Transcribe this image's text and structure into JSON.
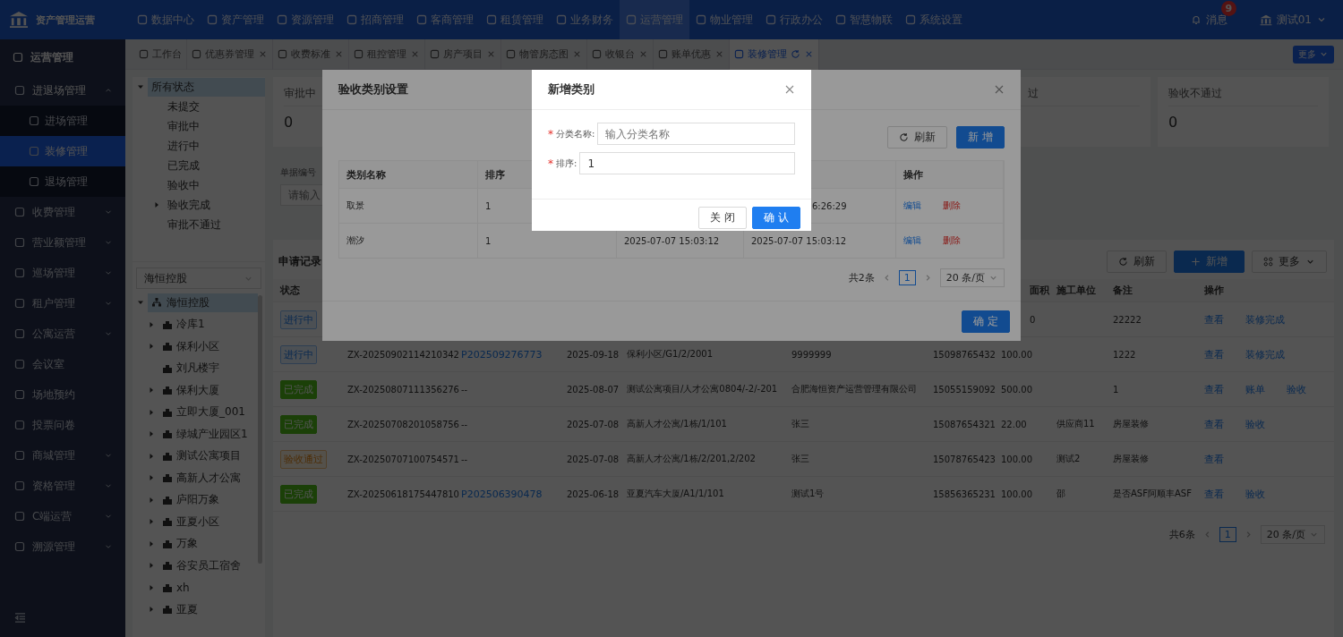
{
  "app": {
    "title": "资产管理运营"
  },
  "top_nav": [
    {
      "label": "数据中心",
      "selected": false
    },
    {
      "label": "资产管理",
      "selected": false
    },
    {
      "label": "资源管理",
      "selected": false
    },
    {
      "label": "招商管理",
      "selected": false
    },
    {
      "label": "客商管理",
      "selected": false
    },
    {
      "label": "租赁管理",
      "selected": false
    },
    {
      "label": "业务财务",
      "selected": false
    },
    {
      "label": "运营管理",
      "selected": true
    },
    {
      "label": "物业管理",
      "selected": false
    },
    {
      "label": "行政办公",
      "selected": false
    },
    {
      "label": "智慧物联",
      "selected": false
    },
    {
      "label": "系统设置",
      "selected": false
    }
  ],
  "messages": {
    "label": "消息",
    "badge": "9"
  },
  "user": {
    "name": "测试01"
  },
  "sidebar": {
    "title": "运营管理",
    "items": [
      {
        "label": "进退场管理",
        "expanded": true,
        "children": [
          {
            "label": "进场管理",
            "selected": false
          },
          {
            "label": "装修管理",
            "selected": true
          },
          {
            "label": "退场管理",
            "selected": false
          }
        ]
      },
      {
        "label": "收费管理",
        "expanded": false
      },
      {
        "label": "营业额管理",
        "expanded": false
      },
      {
        "label": "巡场管理",
        "expanded": false
      },
      {
        "label": "租户管理",
        "expanded": false
      },
      {
        "label": "公寓运营",
        "expanded": false
      },
      {
        "label": "会议室"
      },
      {
        "label": "场地预约"
      },
      {
        "label": "投票问卷"
      },
      {
        "label": "商城管理",
        "expanded": false
      },
      {
        "label": "资格管理",
        "expanded": false
      },
      {
        "label": "C端运营",
        "expanded": false
      },
      {
        "label": "溯源管理",
        "expanded": false
      }
    ]
  },
  "tabs": [
    {
      "label": "工作台",
      "selected": false,
      "closable": false
    },
    {
      "label": "优惠券管理",
      "selected": false,
      "closable": true
    },
    {
      "label": "收费标准",
      "selected": false,
      "closable": true
    },
    {
      "label": "租控管理",
      "selected": false,
      "closable": true
    },
    {
      "label": "房产项目",
      "selected": false,
      "closable": true
    },
    {
      "label": "物管房态图",
      "selected": false,
      "closable": true
    },
    {
      "label": "收银台",
      "selected": false,
      "closable": true
    },
    {
      "label": "账单优惠",
      "selected": false,
      "closable": true
    },
    {
      "label": "装修管理",
      "selected": true,
      "closable": true
    }
  ],
  "more_tabs": "更多",
  "status_tree": {
    "label": "所有状态",
    "expanded": true,
    "selected": true,
    "children": [
      {
        "label": "未提交",
        "has_children": false
      },
      {
        "label": "审批中",
        "has_children": false
      },
      {
        "label": "进行中",
        "has_children": false
      },
      {
        "label": "已完成",
        "has_children": false
      },
      {
        "label": "验收中",
        "has_children": false
      },
      {
        "label": "验收完成",
        "has_children": true
      },
      {
        "label": "审批不通过",
        "has_children": false
      }
    ]
  },
  "org_select": {
    "value": "海恒控股"
  },
  "org_tree": {
    "label": "海恒控股",
    "expanded": true,
    "selected": true,
    "children": [
      {
        "label": "冷库1",
        "has_children": true
      },
      {
        "label": "保利小区",
        "has_children": true
      },
      {
        "label": "刘凡楼宇",
        "has_children": false
      },
      {
        "label": "保利大厦",
        "has_children": true
      },
      {
        "label": "立即大厦_001",
        "has_children": true
      },
      {
        "label": "绿城产业园区1",
        "has_children": true
      },
      {
        "label": "测试公寓项目",
        "has_children": true
      },
      {
        "label": "高新人才公寓",
        "has_children": true
      },
      {
        "label": "庐阳万象",
        "has_children": true
      },
      {
        "label": "亚夏小区",
        "has_children": true
      },
      {
        "label": "万象",
        "has_children": true
      },
      {
        "label": "谷安员工宿舍",
        "has_children": true
      },
      {
        "label": "xh",
        "has_children": true
      },
      {
        "label": "亚夏",
        "has_children": true
      }
    ]
  },
  "stats": [
    {
      "label": "审批中",
      "value": "0"
    },
    {
      "label": "过",
      "cut": true
    },
    {
      "label": "验收不通过",
      "value": "0"
    }
  ],
  "search": {
    "label": "单据编号",
    "placeholder": "请输入"
  },
  "records": {
    "title": "申请记录",
    "refresh": "刷新",
    "add": "新增",
    "more": "更多",
    "columns": [
      {
        "label": "状态"
      },
      null,
      null,
      null,
      null,
      null,
      null,
      {
        "label": "面积",
        "cut": true
      },
      {
        "label": "施工单位"
      },
      {
        "label": "备注"
      },
      {
        "label": "操作"
      }
    ],
    "rows": [
      {
        "cells": [
          {
            "text": "进行中",
            "kind": "processing"
          },
          {
            "text": ""
          },
          {
            "text": ""
          },
          {
            "text": ""
          },
          {
            "text": ""
          },
          {
            "text": ""
          },
          {
            "text": ""
          },
          {
            "text": "0",
            "cut": true
          },
          {
            "text": ""
          },
          {
            "text": "22222"
          }
        ],
        "actions": [
          "查看",
          "装修完成"
        ]
      },
      {
        "cells": [
          {
            "text": "进行中",
            "kind": "processing"
          },
          {
            "text": "ZX-20250902114210342"
          },
          {
            "text": "P202509276773",
            "link": true
          },
          {
            "text": "2025-09-18"
          },
          {
            "text": "保利小区/G1/2/2001"
          },
          {
            "text": "9999999"
          },
          {
            "text": "15098765432"
          },
          {
            "text": "100.00"
          },
          {
            "text": ""
          },
          {
            "text": "1222"
          }
        ],
        "actions": [
          "查看",
          "装修完成"
        ]
      },
      {
        "cells": [
          {
            "text": "已完成",
            "kind": "done"
          },
          {
            "text": "ZX-20250807111356276"
          },
          {
            "text": "--"
          },
          {
            "text": "2025-08-07"
          },
          {
            "text": "测试公寓项目/人才公寓0804/-2/-201"
          },
          {
            "text": "合肥海恒资产运营管理有限公司"
          },
          {
            "text": "15055159092"
          },
          {
            "text": "500.00"
          },
          {
            "text": ""
          },
          {
            "text": "1"
          }
        ],
        "actions": [
          "查看",
          "账单",
          "验收"
        ]
      },
      {
        "cells": [
          {
            "text": "已完成",
            "kind": "done"
          },
          {
            "text": "ZX-20250708201058756"
          },
          {
            "text": "--"
          },
          {
            "text": "2025-07-08"
          },
          {
            "text": "高新人才公寓/1栋/1/101"
          },
          {
            "text": "张三"
          },
          {
            "text": "15087654321"
          },
          {
            "text": "22.00"
          },
          {
            "text": "供应商11"
          },
          {
            "text": "房屋装修"
          }
        ],
        "actions": [
          "查看",
          "验收"
        ]
      },
      {
        "cells": [
          {
            "text": "验收通过",
            "kind": "passed"
          },
          {
            "text": "ZX-20250707100754571"
          },
          {
            "text": "--"
          },
          {
            "text": "2025-07-08"
          },
          {
            "text": "高新人才公寓/1栋/2/201,2/202"
          },
          {
            "text": "张三"
          },
          {
            "text": "15078765423"
          },
          {
            "text": "100.00"
          },
          {
            "text": "测试2"
          },
          {
            "text": "房屋装修"
          }
        ],
        "actions": [
          "查看"
        ]
      },
      {
        "cells": [
          {
            "text": "已完成",
            "kind": "done"
          },
          {
            "text": "ZX-20250618175447810"
          },
          {
            "text": "P202506390478",
            "link": true
          },
          {
            "text": "2025-06-18"
          },
          {
            "text": "亚夏汽车大厦/A1/1/101"
          },
          {
            "text": "测试1号"
          },
          {
            "text": "15856365231"
          },
          {
            "text": "100.00"
          },
          {
            "text": "邵"
          },
          {
            "text": "是否ASF阿顺丰ASF"
          }
        ],
        "actions": [
          "查看",
          "验收"
        ]
      }
    ],
    "pagination": {
      "total": "共6条",
      "page": "1",
      "size": "20 条/页"
    }
  },
  "category_dialog": {
    "title": "验收类别设置",
    "refresh": "刷新",
    "add": "新 增",
    "columns": [
      "类别名称",
      "排序",
      "操作"
    ],
    "rows": [
      {
        "name": "取景",
        "sort": "1",
        "created": null,
        "updated": {
          "text": "6:26:29",
          "cut": true
        },
        "actions": [
          {
            "text": "编辑",
            "kind": "edit"
          },
          {
            "text": "删除",
            "kind": "delete"
          }
        ]
      },
      {
        "name": "潮汐",
        "sort": "1",
        "created": "2025-07-07 15:03:12",
        "updated": {
          "text": "2025-07-07 15:03:12",
          "cut": false
        },
        "actions": [
          {
            "text": "编辑",
            "kind": "edit"
          },
          {
            "text": "删除",
            "kind": "delete"
          }
        ]
      }
    ],
    "pagination": {
      "total": "共2条",
      "page": "1",
      "size": "20 条/页"
    },
    "confirm": "确 定"
  },
  "add_dialog": {
    "title": "新增类别",
    "fields": [
      {
        "mark": "*",
        "label": "分类名称:",
        "placeholder": "输入分类名称"
      },
      {
        "mark": "*",
        "label": "排序:",
        "value": "1"
      }
    ],
    "cancel": "关 闭",
    "confirm": "确 认"
  }
}
